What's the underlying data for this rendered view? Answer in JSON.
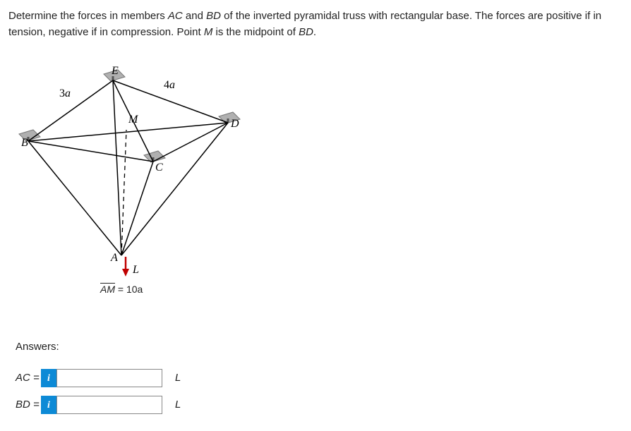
{
  "problem": {
    "text_part1": "Determine the forces in members ",
    "var_ac": "AC",
    "text_part2": " and ",
    "var_bd": "BD",
    "text_part3": " of the inverted pyramidal truss with rectangular base. The forces are positive if in tension, negative if in compression. Point ",
    "var_m": "M",
    "text_part4": " is the midpoint of ",
    "var_bd2": "BD",
    "text_part5": "."
  },
  "diagram": {
    "label_E": "E",
    "label_4a": "4a",
    "label_3a": "3a",
    "label_B": "B",
    "label_M": "M",
    "label_D": "D",
    "label_C": "C",
    "label_A": "A",
    "label_L": "L",
    "am_text1": "AM",
    "am_text2": " = 10a"
  },
  "answers": {
    "heading": "Answers:",
    "rows": [
      {
        "lhs": "AC =",
        "info": "i",
        "value": "",
        "unit": "L"
      },
      {
        "lhs": "BD =",
        "info": "i",
        "value": "",
        "unit": "L"
      }
    ]
  }
}
